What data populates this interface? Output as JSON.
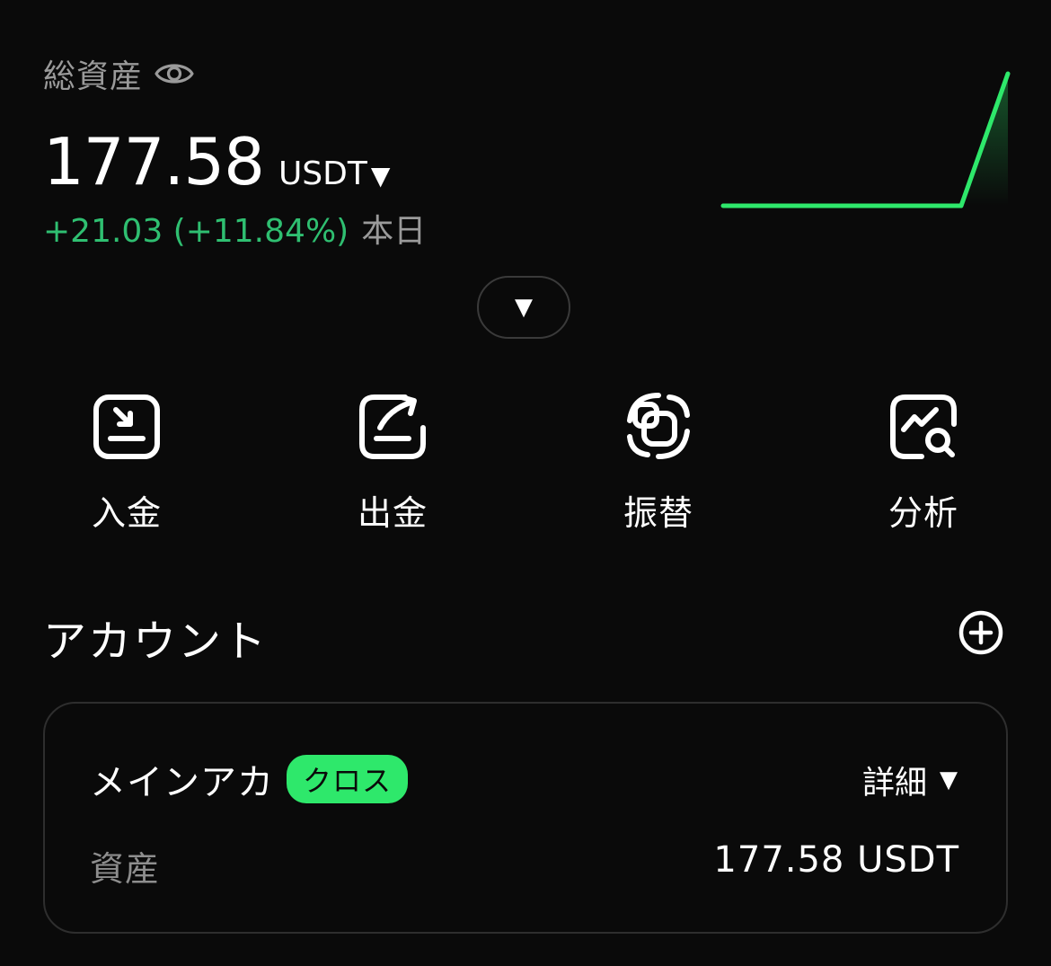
{
  "header": {
    "total_label": "総資産",
    "balance": "177.58",
    "currency": "USDT",
    "currency_caret": "▼",
    "change": "+21.03 (+11.84%)",
    "change_period": "本日",
    "expand_caret": "▼"
  },
  "colors": {
    "background": "#0a0a0a",
    "positive": "#2fbf71",
    "accent": "#2ee86b",
    "muted": "#9a9a9a"
  },
  "actions": [
    {
      "label": "入金",
      "icon": "deposit-icon"
    },
    {
      "label": "出金",
      "icon": "withdraw-icon"
    },
    {
      "label": "振替",
      "icon": "transfer-icon"
    },
    {
      "label": "分析",
      "icon": "analysis-icon"
    }
  ],
  "accounts": {
    "title": "アカウント",
    "add_icon": "add-circle-icon",
    "items": [
      {
        "name": "メインアカ",
        "badge": "クロス",
        "details_label": "詳細",
        "details_caret": "▼",
        "asset_label": "資産",
        "asset_value": "177.58 USDT"
      }
    ]
  }
}
